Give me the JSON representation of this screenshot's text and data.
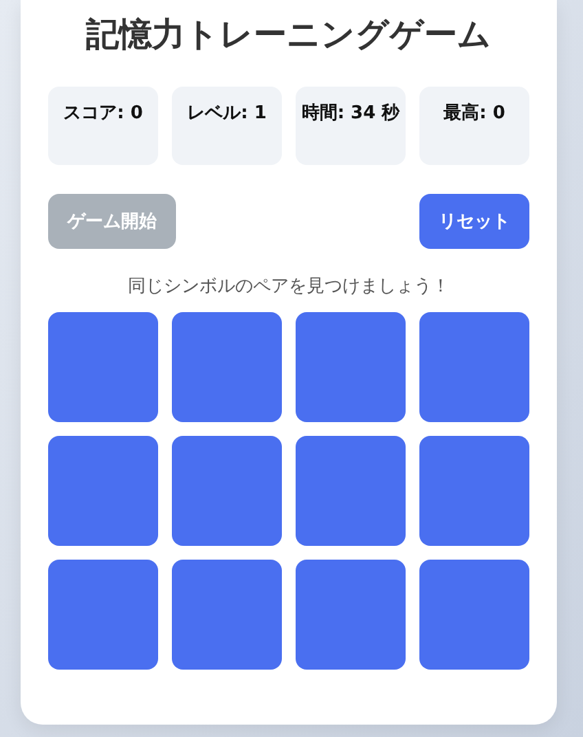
{
  "title": "記憶力トレーニングゲーム",
  "stats": [
    {
      "text": "スコア: 0"
    },
    {
      "text": "レベル: 1"
    },
    {
      "text": "時間: 34 秒"
    },
    {
      "text": "最高: 0"
    }
  ],
  "buttons": [
    {
      "label": "ゲーム開始",
      "disabled": true
    },
    {
      "label": "リセット",
      "disabled": false
    }
  ],
  "hint": "同じシンボルのペアを見つけましょう！",
  "cards": [
    {
      "flipped": false
    },
    {
      "flipped": false
    },
    {
      "flipped": false
    },
    {
      "flipped": false
    },
    {
      "flipped": false
    },
    {
      "flipped": false
    },
    {
      "flipped": false
    },
    {
      "flipped": false
    },
    {
      "flipped": false
    },
    {
      "flipped": false
    },
    {
      "flipped": false
    },
    {
      "flipped": false
    }
  ]
}
